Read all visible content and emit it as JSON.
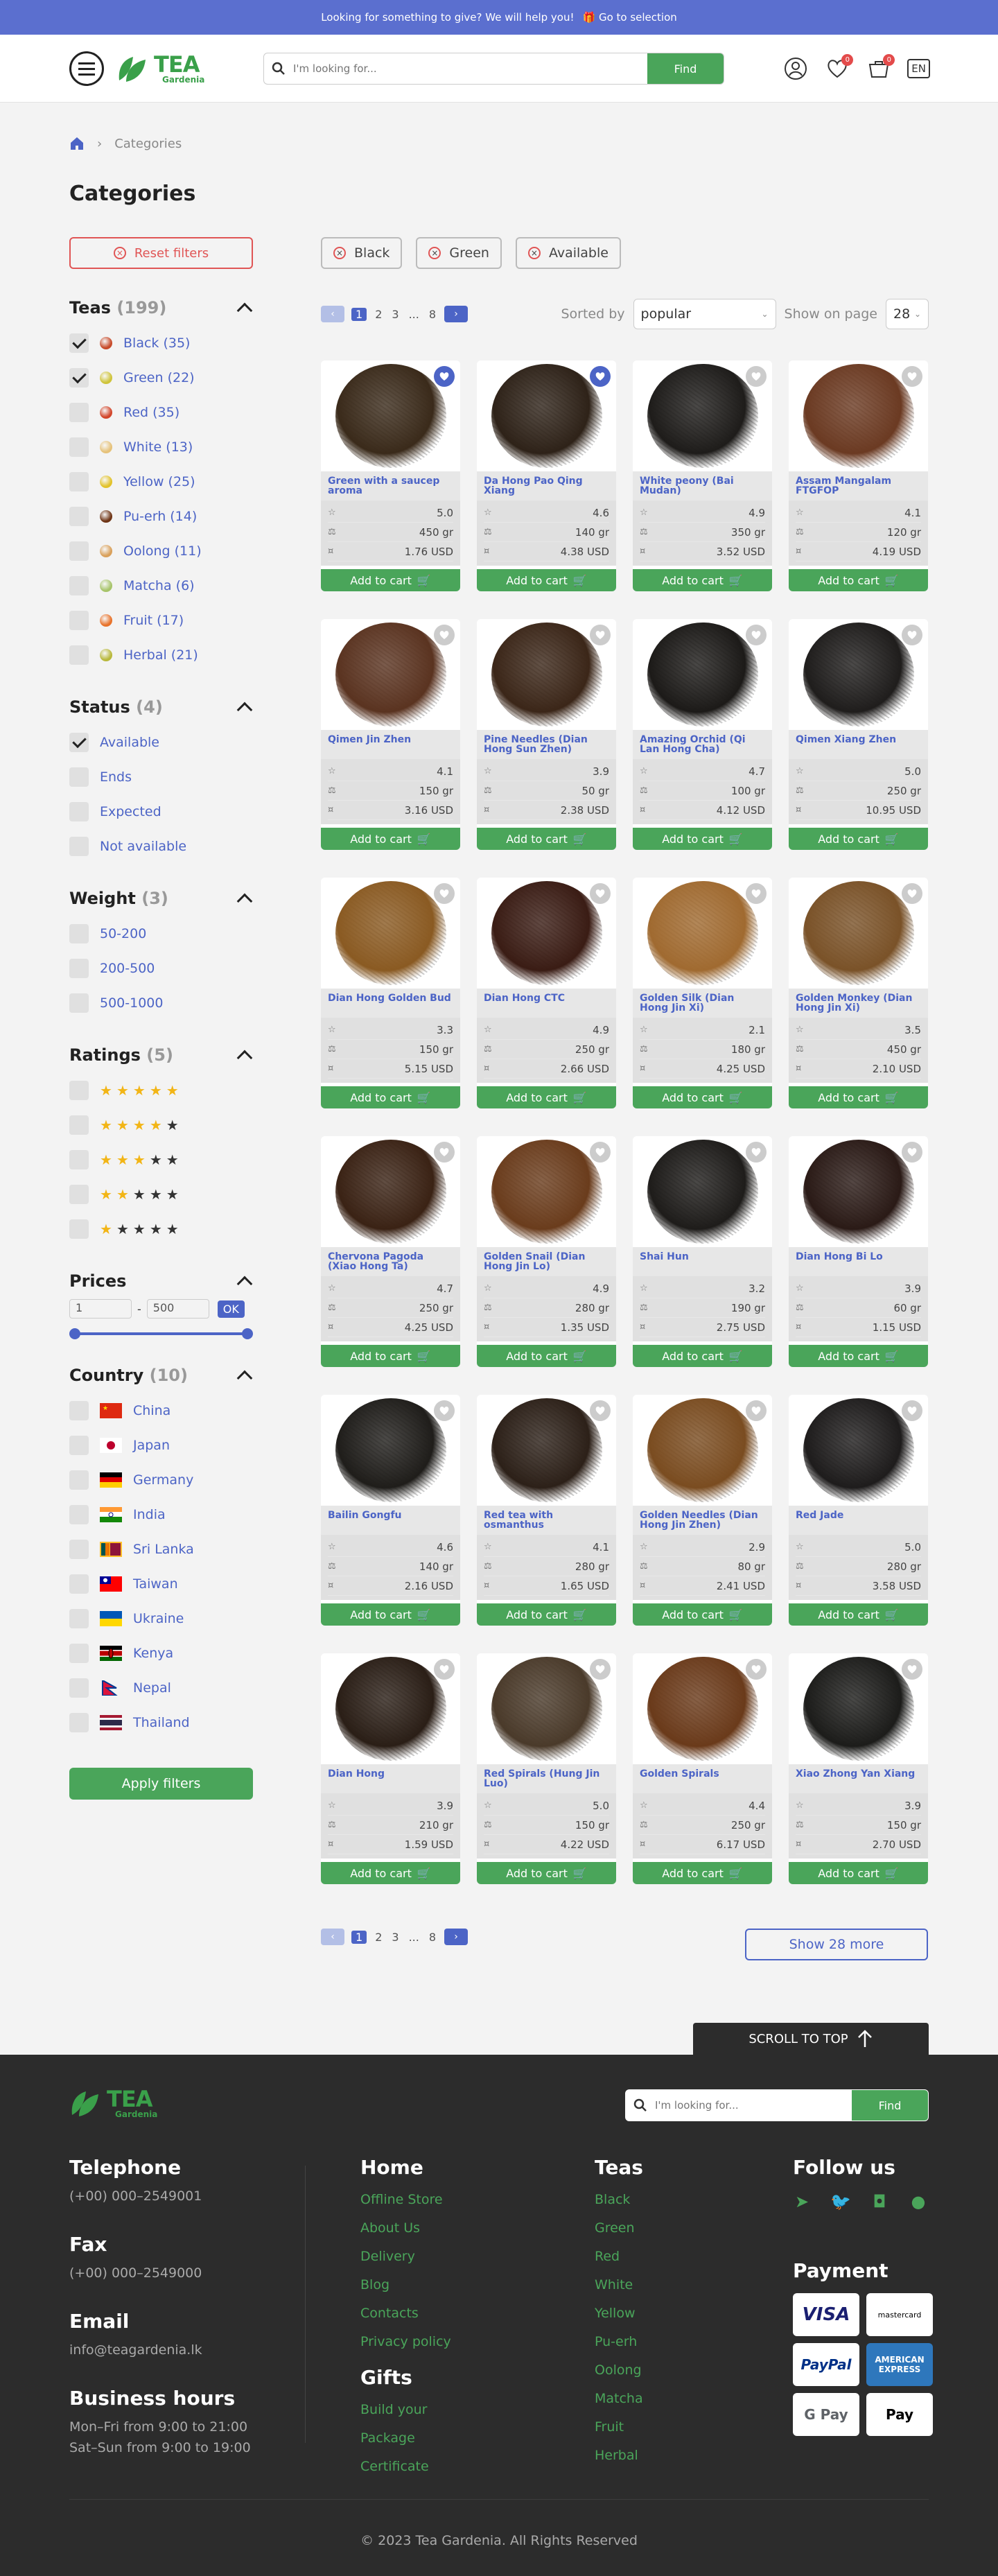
{
  "topbar": {
    "text": "Looking for something to give? We will help you!",
    "link": "Go to selection"
  },
  "header": {
    "logo_main": "TEA",
    "logo_sub": "Gardenia",
    "search_placeholder": "I'm looking for...",
    "search_button": "Find",
    "favorites_badge": "0",
    "cart_badge": "0",
    "lang": "EN"
  },
  "breadcrumb": {
    "current": "Categories"
  },
  "page": {
    "title": "Categories"
  },
  "filters": {
    "reset": "Reset filters",
    "teas": {
      "title": "Teas",
      "count": "(199)",
      "items": [
        {
          "label": "Black (35)",
          "checked": true,
          "color": "#c74a2a"
        },
        {
          "label": "Green (22)",
          "checked": true,
          "color": "#cfc43a"
        },
        {
          "label": "Red (35)",
          "checked": false,
          "color": "#d2452a"
        },
        {
          "label": "White (13)",
          "checked": false,
          "color": "#e6c27a"
        },
        {
          "label": "Yellow (25)",
          "checked": false,
          "color": "#e2c22a"
        },
        {
          "label": "Pu-erh (14)",
          "checked": false,
          "color": "#6e3415"
        },
        {
          "label": "Oolong (11)",
          "checked": false,
          "color": "#d9a05a"
        },
        {
          "label": "Matcha (6)",
          "checked": false,
          "color": "#a7c46a"
        },
        {
          "label": "Fruit (17)",
          "checked": false,
          "color": "#e8722a"
        },
        {
          "label": "Herbal (21)",
          "checked": false,
          "color": "#b8b83a"
        }
      ]
    },
    "status": {
      "title": "Status",
      "count": "(4)",
      "items": [
        {
          "label": "Available",
          "checked": true
        },
        {
          "label": "Ends",
          "checked": false
        },
        {
          "label": "Expected",
          "checked": false
        },
        {
          "label": "Not available",
          "checked": false
        }
      ]
    },
    "weight": {
      "title": "Weight",
      "count": "(3)",
      "items": [
        {
          "label": "50-200"
        },
        {
          "label": "200-500"
        },
        {
          "label": "500-1000"
        }
      ]
    },
    "ratings": {
      "title": "Ratings",
      "count": "(5)",
      "items": [
        5,
        4,
        3,
        2,
        1
      ]
    },
    "prices": {
      "title": "Prices",
      "min": "1",
      "max": "500",
      "ok": "OK",
      "sep": "-"
    },
    "country": {
      "title": "Country",
      "count": "(10)",
      "items": [
        {
          "label": "China",
          "flag": "china"
        },
        {
          "label": "Japan",
          "flag": "japan"
        },
        {
          "label": "Germany",
          "flag": "germany"
        },
        {
          "label": "India",
          "flag": "india"
        },
        {
          "label": "Sri Lanka",
          "flag": "srilanka"
        },
        {
          "label": "Taiwan",
          "flag": "taiwan"
        },
        {
          "label": "Ukraine",
          "flag": "ukraine"
        },
        {
          "label": "Kenya",
          "flag": "kenya"
        },
        {
          "label": "Nepal",
          "flag": "nepal"
        },
        {
          "label": "Thailand",
          "flag": "thailand"
        }
      ]
    },
    "apply": "Apply filters"
  },
  "chips": [
    "Black",
    "Green",
    "Available"
  ],
  "pagination": {
    "prev": "‹",
    "next": "›",
    "pages": [
      "1",
      "2",
      "3",
      "...",
      "8"
    ]
  },
  "sort": {
    "label": "Sorted by",
    "value": "popular",
    "show_label": "Show on page",
    "show_value": "28"
  },
  "add_to_cart": "Add to cart",
  "products": [
    {
      "name": "Green with a saucep aroma",
      "rating": "5.0",
      "weight": "450 gr",
      "price": "1.76 USD",
      "fav": true,
      "tone": "#3a2a1a"
    },
    {
      "name": "Da Hong Pao Qing Xiang",
      "rating": "4.6",
      "weight": "140 gr",
      "price": "4.38 USD",
      "fav": true,
      "tone": "#2e2218"
    },
    {
      "name": "White peony (Bai Mudan)",
      "rating": "4.9",
      "weight": "350 gr",
      "price": "3.52 USD",
      "fav": false,
      "tone": "#1e1c1a"
    },
    {
      "name": "Assam Mangalam FTGFOP",
      "rating": "4.1",
      "weight": "120 gr",
      "price": "4.19 USD",
      "fav": false,
      "tone": "#6b3a22"
    },
    {
      "name": "Qimen Jin Zhen",
      "rating": "4.1",
      "weight": "150 gr",
      "price": "3.16 USD",
      "fav": false,
      "tone": "#5a3320"
    },
    {
      "name": "Pine Needles (Dian Hong Sun Zhen)",
      "rating": "3.9",
      "weight": "50 gr",
      "price": "2.38 USD",
      "fav": false,
      "tone": "#3b2618"
    },
    {
      "name": "Amazing Orchid (Qi Lan Hong Cha)",
      "rating": "4.7",
      "weight": "100 gr",
      "price": "4.12 USD",
      "fav": false,
      "tone": "#1c1a18"
    },
    {
      "name": "Qimen Xiang Zhen",
      "rating": "5.0",
      "weight": "250 gr",
      "price": "10.95 USD",
      "fav": false,
      "tone": "#1f1d1c"
    },
    {
      "name": "Dian Hong Golden Bud",
      "rating": "3.3",
      "weight": "150 gr",
      "price": "5.15 USD",
      "fav": false,
      "tone": "#8a5a22"
    },
    {
      "name": "Dian Hong CTC",
      "rating": "4.9",
      "weight": "250 gr",
      "price": "2.66 USD",
      "fav": false,
      "tone": "#3a1c14"
    },
    {
      "name": "Golden Silk (Dian Hong Jin Xi)",
      "rating": "2.1",
      "weight": "180 gr",
      "price": "4.25 USD",
      "fav": false,
      "tone": "#a06a30"
    },
    {
      "name": "Golden Monkey (Dian Hong Jin Xi)",
      "rating": "3.5",
      "weight": "450 gr",
      "price": "2.10 USD",
      "fav": false,
      "tone": "#7a5228"
    },
    {
      "name": "Chervona Pagoda (Xiao Hong Ta)",
      "rating": "4.7",
      "weight": "250 gr",
      "price": "4.25 USD",
      "fav": false,
      "tone": "#3a2214"
    },
    {
      "name": "Golden Snail (Dian Hong Jin Lo)",
      "rating": "4.9",
      "weight": "280 gr",
      "price": "1.35 USD",
      "fav": false,
      "tone": "#6a3c1c"
    },
    {
      "name": "Shai Hun",
      "rating": "3.2",
      "weight": "190 gr",
      "price": "2.75 USD",
      "fav": false,
      "tone": "#1e1c1a"
    },
    {
      "name": "Dian Hong Bi Lo",
      "rating": "3.9",
      "weight": "60 gr",
      "price": "1.15 USD",
      "fav": false,
      "tone": "#2a1a16"
    },
    {
      "name": "Bailin Gongfu",
      "rating": "4.6",
      "weight": "140 gr",
      "price": "2.16 USD",
      "fav": false,
      "tone": "#1f1d1a"
    },
    {
      "name": "Red tea with osmanthus",
      "rating": "4.1",
      "weight": "280 gr",
      "price": "1.65 USD",
      "fav": false,
      "tone": "#2c2018"
    },
    {
      "name": "Golden Needles (Dian Hong Jin Zhen)",
      "rating": "2.9",
      "weight": "80 gr",
      "price": "2.41 USD",
      "fav": false,
      "tone": "#7a4c20"
    },
    {
      "name": "Red Jade",
      "rating": "5.0",
      "weight": "280 gr",
      "price": "3.58 USD",
      "fav": false,
      "tone": "#1e1c1c"
    },
    {
      "name": "Dian Hong",
      "rating": "3.9",
      "weight": "210 gr",
      "price": "1.59 USD",
      "fav": false,
      "tone": "#2a1e16"
    },
    {
      "name": "Red Spirals (Hung Jin Luo)",
      "rating": "5.0",
      "weight": "150 gr",
      "price": "4.22 USD",
      "fav": false,
      "tone": "#4a3a2a"
    },
    {
      "name": "Golden Spirals",
      "rating": "4.4",
      "weight": "250 gr",
      "price": "6.17 USD",
      "fav": false,
      "tone": "#6a3a1a"
    },
    {
      "name": "Xiao Zhong Yan Xiang",
      "rating": "3.9",
      "weight": "150 gr",
      "price": "2.70 USD",
      "fav": false,
      "tone": "#1c1c1a"
    }
  ],
  "show_more": "Show 28 more",
  "scroll_top": "SCROLL TO TOP",
  "footer": {
    "logo_main": "TEA",
    "logo_sub": "Gardenia",
    "search_placeholder": "I'm looking for...",
    "search_button": "Find",
    "telephone_h": "Telephone",
    "telephone": "(+00) 000–2549001",
    "fax_h": "Fax",
    "fax": "(+00) 000–2549000",
    "email_h": "Email",
    "email": "info@teagardenia.lk",
    "hours_h": "Business hours",
    "hours1": "Mon–Fri from 9:00 to 21:00",
    "hours2": "Sat–Sun from 9:00 to 19:00",
    "home_h": "Home",
    "home": [
      "Offline Store",
      "About Us",
      "Delivery",
      "Blog",
      "Contacts",
      "Privacy policy"
    ],
    "gifts_h": "Gifts",
    "gifts": [
      "Build your",
      "Package",
      "Certificate"
    ],
    "teas_h": "Teas",
    "teas": [
      "Black",
      "Green",
      "Red",
      "White",
      "Yellow",
      "Pu-erh",
      "Oolong",
      "Matcha",
      "Fruit",
      "Herbal"
    ],
    "follow_h": "Follow us",
    "payment_h": "Payment",
    "payments": [
      "VISA",
      "mastercard",
      "PayPal",
      "AMERICAN EXPRESS",
      "G Pay",
      "Pay"
    ],
    "copyright": "© 2023 Tea Gardenia. All Rights Reserved"
  }
}
